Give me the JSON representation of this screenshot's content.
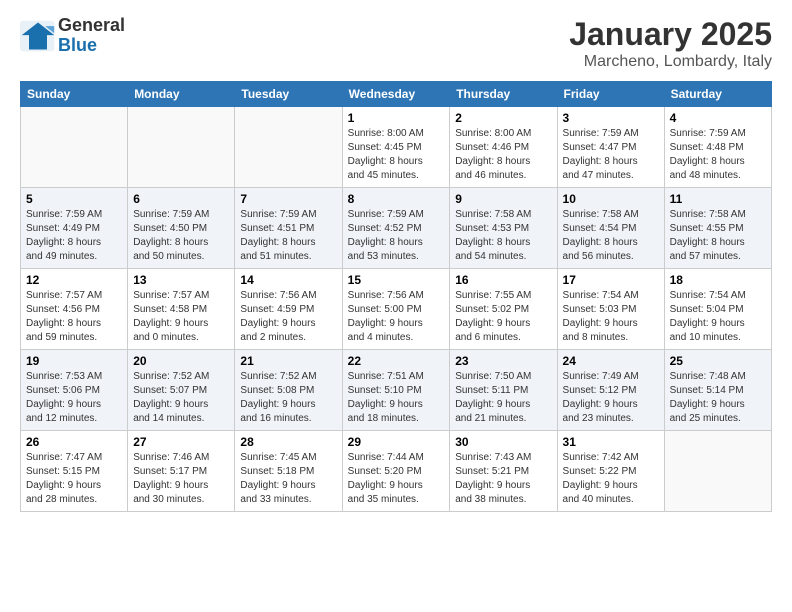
{
  "header": {
    "logo_line1": "General",
    "logo_line2": "Blue",
    "month_title": "January 2025",
    "location": "Marcheno, Lombardy, Italy"
  },
  "weekdays": [
    "Sunday",
    "Monday",
    "Tuesday",
    "Wednesday",
    "Thursday",
    "Friday",
    "Saturday"
  ],
  "weeks": [
    [
      {
        "day": "",
        "info": ""
      },
      {
        "day": "",
        "info": ""
      },
      {
        "day": "",
        "info": ""
      },
      {
        "day": "1",
        "info": "Sunrise: 8:00 AM\nSunset: 4:45 PM\nDaylight: 8 hours\nand 45 minutes."
      },
      {
        "day": "2",
        "info": "Sunrise: 8:00 AM\nSunset: 4:46 PM\nDaylight: 8 hours\nand 46 minutes."
      },
      {
        "day": "3",
        "info": "Sunrise: 7:59 AM\nSunset: 4:47 PM\nDaylight: 8 hours\nand 47 minutes."
      },
      {
        "day": "4",
        "info": "Sunrise: 7:59 AM\nSunset: 4:48 PM\nDaylight: 8 hours\nand 48 minutes."
      }
    ],
    [
      {
        "day": "5",
        "info": "Sunrise: 7:59 AM\nSunset: 4:49 PM\nDaylight: 8 hours\nand 49 minutes."
      },
      {
        "day": "6",
        "info": "Sunrise: 7:59 AM\nSunset: 4:50 PM\nDaylight: 8 hours\nand 50 minutes."
      },
      {
        "day": "7",
        "info": "Sunrise: 7:59 AM\nSunset: 4:51 PM\nDaylight: 8 hours\nand 51 minutes."
      },
      {
        "day": "8",
        "info": "Sunrise: 7:59 AM\nSunset: 4:52 PM\nDaylight: 8 hours\nand 53 minutes."
      },
      {
        "day": "9",
        "info": "Sunrise: 7:58 AM\nSunset: 4:53 PM\nDaylight: 8 hours\nand 54 minutes."
      },
      {
        "day": "10",
        "info": "Sunrise: 7:58 AM\nSunset: 4:54 PM\nDaylight: 8 hours\nand 56 minutes."
      },
      {
        "day": "11",
        "info": "Sunrise: 7:58 AM\nSunset: 4:55 PM\nDaylight: 8 hours\nand 57 minutes."
      }
    ],
    [
      {
        "day": "12",
        "info": "Sunrise: 7:57 AM\nSunset: 4:56 PM\nDaylight: 8 hours\nand 59 minutes."
      },
      {
        "day": "13",
        "info": "Sunrise: 7:57 AM\nSunset: 4:58 PM\nDaylight: 9 hours\nand 0 minutes."
      },
      {
        "day": "14",
        "info": "Sunrise: 7:56 AM\nSunset: 4:59 PM\nDaylight: 9 hours\nand 2 minutes."
      },
      {
        "day": "15",
        "info": "Sunrise: 7:56 AM\nSunset: 5:00 PM\nDaylight: 9 hours\nand 4 minutes."
      },
      {
        "day": "16",
        "info": "Sunrise: 7:55 AM\nSunset: 5:02 PM\nDaylight: 9 hours\nand 6 minutes."
      },
      {
        "day": "17",
        "info": "Sunrise: 7:54 AM\nSunset: 5:03 PM\nDaylight: 9 hours\nand 8 minutes."
      },
      {
        "day": "18",
        "info": "Sunrise: 7:54 AM\nSunset: 5:04 PM\nDaylight: 9 hours\nand 10 minutes."
      }
    ],
    [
      {
        "day": "19",
        "info": "Sunrise: 7:53 AM\nSunset: 5:06 PM\nDaylight: 9 hours\nand 12 minutes."
      },
      {
        "day": "20",
        "info": "Sunrise: 7:52 AM\nSunset: 5:07 PM\nDaylight: 9 hours\nand 14 minutes."
      },
      {
        "day": "21",
        "info": "Sunrise: 7:52 AM\nSunset: 5:08 PM\nDaylight: 9 hours\nand 16 minutes."
      },
      {
        "day": "22",
        "info": "Sunrise: 7:51 AM\nSunset: 5:10 PM\nDaylight: 9 hours\nand 18 minutes."
      },
      {
        "day": "23",
        "info": "Sunrise: 7:50 AM\nSunset: 5:11 PM\nDaylight: 9 hours\nand 21 minutes."
      },
      {
        "day": "24",
        "info": "Sunrise: 7:49 AM\nSunset: 5:12 PM\nDaylight: 9 hours\nand 23 minutes."
      },
      {
        "day": "25",
        "info": "Sunrise: 7:48 AM\nSunset: 5:14 PM\nDaylight: 9 hours\nand 25 minutes."
      }
    ],
    [
      {
        "day": "26",
        "info": "Sunrise: 7:47 AM\nSunset: 5:15 PM\nDaylight: 9 hours\nand 28 minutes."
      },
      {
        "day": "27",
        "info": "Sunrise: 7:46 AM\nSunset: 5:17 PM\nDaylight: 9 hours\nand 30 minutes."
      },
      {
        "day": "28",
        "info": "Sunrise: 7:45 AM\nSunset: 5:18 PM\nDaylight: 9 hours\nand 33 minutes."
      },
      {
        "day": "29",
        "info": "Sunrise: 7:44 AM\nSunset: 5:20 PM\nDaylight: 9 hours\nand 35 minutes."
      },
      {
        "day": "30",
        "info": "Sunrise: 7:43 AM\nSunset: 5:21 PM\nDaylight: 9 hours\nand 38 minutes."
      },
      {
        "day": "31",
        "info": "Sunrise: 7:42 AM\nSunset: 5:22 PM\nDaylight: 9 hours\nand 40 minutes."
      },
      {
        "day": "",
        "info": ""
      }
    ]
  ]
}
